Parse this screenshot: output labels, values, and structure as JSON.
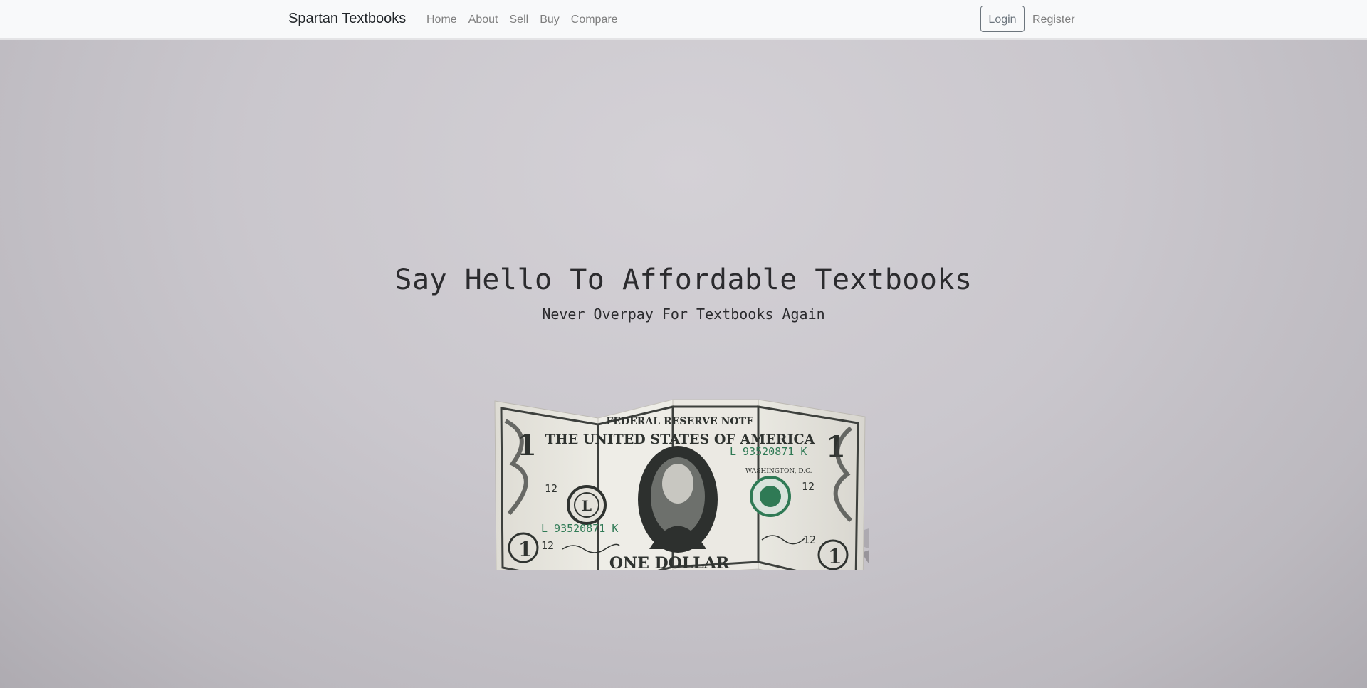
{
  "nav": {
    "brand": "Spartan Textbooks",
    "links": [
      "Home",
      "About",
      "Sell",
      "Buy",
      "Compare"
    ],
    "login_label": "Login",
    "register_label": "Register"
  },
  "hero": {
    "title": "Say Hello To Affordable Textbooks",
    "subtitle": "Never Overpay For Textbooks Again",
    "bill": {
      "header": "FEDERAL RESERVE NOTE",
      "country": "THE UNITED STATES OF AMERICA",
      "serial": "L 93520871 K",
      "district": "12",
      "letter": "L",
      "denomination_word": "ONE DOLLAR",
      "denomination_number": "1",
      "place": "WASHINGTON, D.C."
    }
  },
  "colors": {
    "navbar_bg": "#f8f9fa",
    "hero_bg": "#cac7cd",
    "text_dark": "#2b2b2e",
    "nav_link": "#7f7f7f",
    "bill_paper": "#e8e6df",
    "bill_ink": "#2f3330",
    "bill_seal_green": "#2f7a55"
  }
}
